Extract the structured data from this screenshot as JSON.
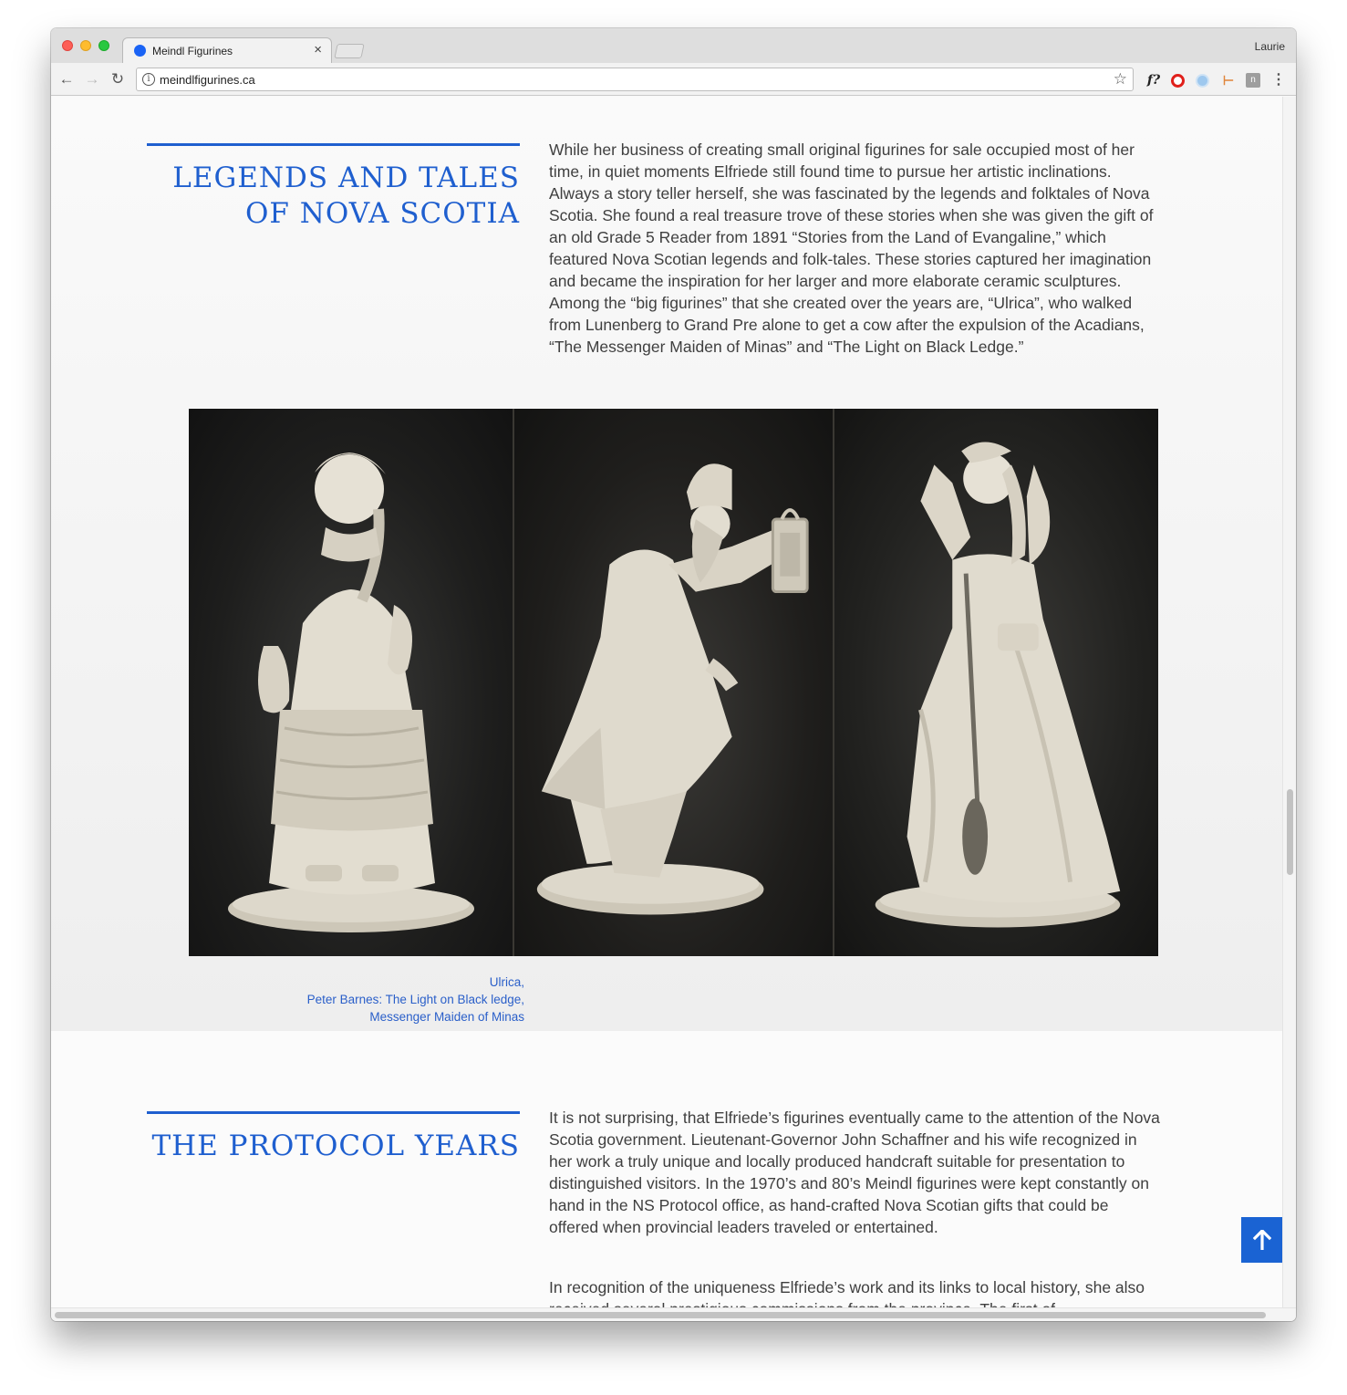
{
  "browser": {
    "tab_title": "Meindl Figurines",
    "tab_close": "×",
    "profile_name": "Laurie",
    "url": "meindlfigurines.ca",
    "info_glyph": "i",
    "star_glyph": "☆",
    "back_glyph": "←",
    "forward_glyph": "→",
    "reload_glyph": "↻",
    "menu_glyph": "⋮",
    "ext_f_label": "f?",
    "ext_tag_glyph": "⊢",
    "ext_book_label": "n"
  },
  "legends_section": {
    "heading_line1": "LEGENDS AND TALES",
    "heading_line2": "OF NOVA SCOTIA",
    "body": "While her business of creating small original figurines for sale occupied most of her time, in quiet moments Elfriede still found time to pursue her artistic inclinations. Always a story teller herself, she was fascinated by the legends and folktales of Nova Scotia. She found a real treasure trove of these stories when she was given the gift of an old Grade 5 Reader from 1891 “Stories from the Land of Evangaline,” which featured Nova Scotian legends and folk-tales. These stories captured her imagination and became the inspiration for her larger and more elaborate ceramic sculptures. Among the “big figurines” that she created over the years are, “Ulrica”, who walked from Lunenberg to Grand Pre alone to get a cow after the expulsion of the Acadians, “The Messenger Maiden of Minas” and “The Light on Black Ledge.”",
    "caption_line1": "Ulrica,",
    "caption_line2": "Peter Barnes: The Light on Black ledge,",
    "caption_line3": "Messenger Maiden of Minas"
  },
  "protocol_section": {
    "heading": "THE PROTOCOL YEARS",
    "body_p1": "It is not surprising, that Elfriede’s figurines eventually came to the attention of the Nova Scotia government. Lieutenant-Governor John Schaffner and his wife recognized in her work a truly unique and locally produced handcraft suitable for presentation to distinguished visitors. In the 1970’s and 80’s Meindl figurines were kept constantly on hand in the NS Protocol office, as hand-crafted Nova Scotian gifts that could be offered when provincial leaders traveled or entertained.",
    "body_p2": "In recognition of the uniqueness Elfriede’s work and its links to local history, she also received several prestigious commissions from the province. The first of"
  },
  "colors": {
    "accent_blue": "#1f5fcf",
    "body_text": "#3f3f3f",
    "caption_blue": "#2a5fc9",
    "to_top_bg": "#1a63d3"
  },
  "icons": {
    "to_top": "arrow-up-icon",
    "favicon": "blue-circle-icon"
  }
}
